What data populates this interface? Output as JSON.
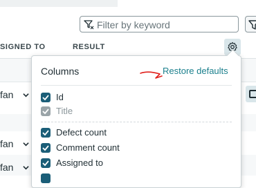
{
  "search": {
    "placeholder": "Filter by keyword"
  },
  "table": {
    "columns": [
      "SIGNED TO",
      "RESULT"
    ],
    "rows": [
      {
        "user": ""
      },
      {
        "user": "fan"
      },
      {
        "user": ""
      },
      {
        "user": "fan"
      },
      {
        "user": "fan"
      }
    ]
  },
  "column_picker": {
    "title": "Columns",
    "restore_label": "Restore defaults",
    "options": [
      {
        "label": "Id",
        "checked": true,
        "disabled": false
      },
      {
        "label": "Title",
        "checked": true,
        "disabled": true
      },
      {
        "label": "Defect count",
        "checked": true,
        "disabled": false
      },
      {
        "label": "Comment count",
        "checked": true,
        "disabled": false
      },
      {
        "label": "Assigned to",
        "checked": true,
        "disabled": false
      },
      {
        "label": "",
        "checked": true,
        "disabled": false
      }
    ]
  },
  "colors": {
    "accent": "#1a7f8c",
    "checkbox": "#1b5e78",
    "annotation": "#e0201c"
  },
  "icons": [
    "filter-icon",
    "funnel-icon",
    "gear-icon",
    "chevron-down-icon",
    "checkmark-icon",
    "panel-toggle-icon"
  ]
}
